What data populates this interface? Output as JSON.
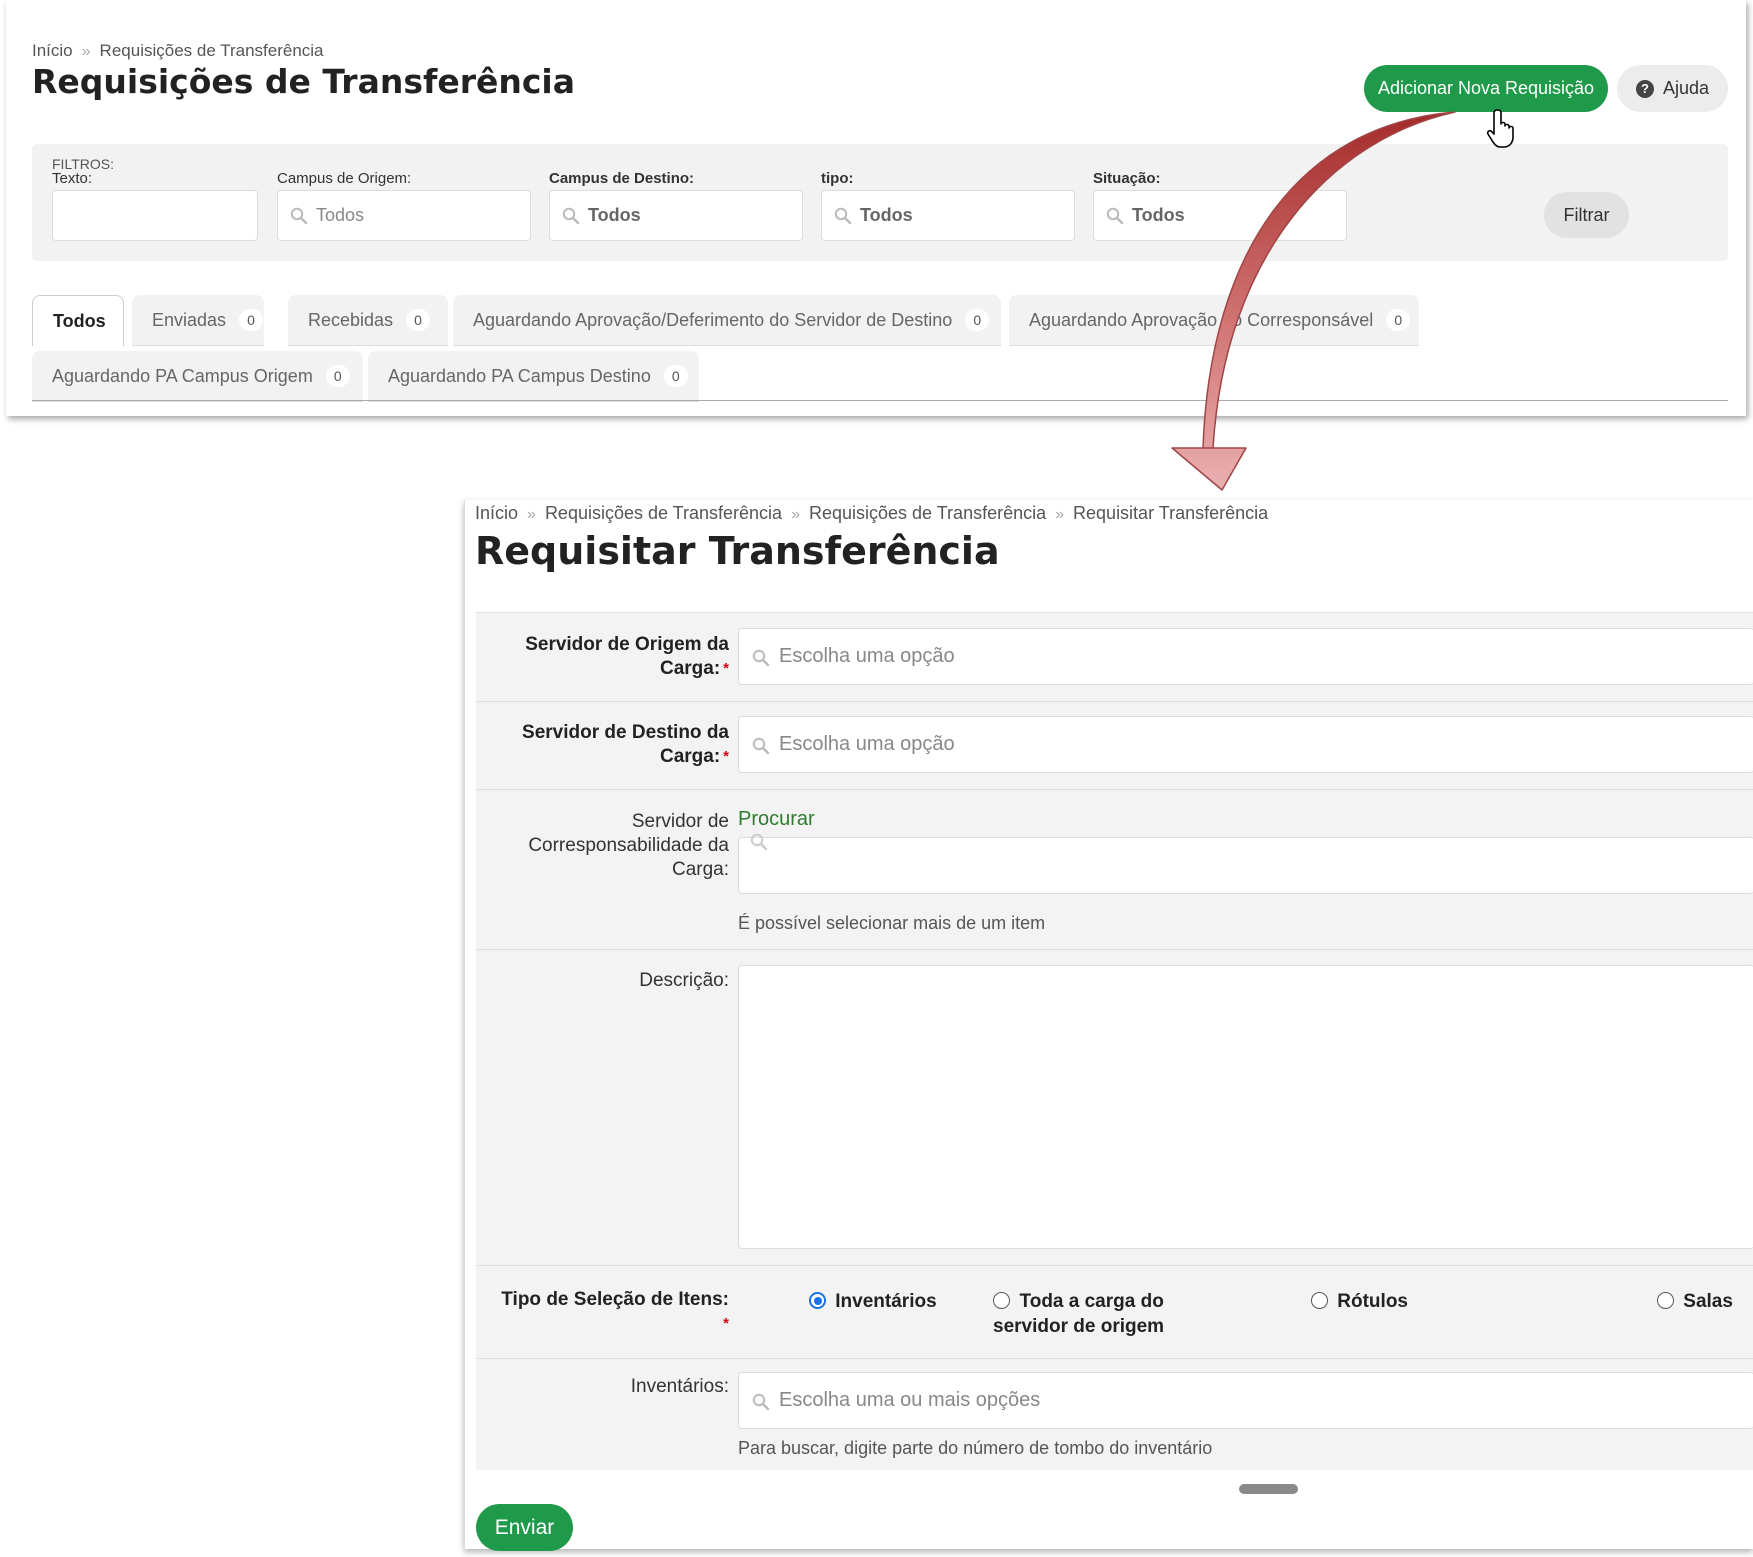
{
  "list_page": {
    "breadcrumb": [
      "Início",
      "Requisições de Transferência"
    ],
    "title": "Requisições de Transferência",
    "add_button": "Adicionar Nova Requisição",
    "help_button": "Ajuda",
    "filters": {
      "title": "FILTROS:",
      "fields": [
        {
          "label": "Texto:",
          "value": ""
        },
        {
          "label": "Campus de Origem:",
          "value": "Todos"
        },
        {
          "label": "Campus de Destino:",
          "value": "Todos"
        },
        {
          "label": "tipo:",
          "value": "Todos"
        },
        {
          "label": "Situação:",
          "value": "Todos"
        }
      ],
      "filter_button": "Filtrar"
    },
    "tabs": [
      {
        "label": "Todos",
        "count": ""
      },
      {
        "label": "Enviadas",
        "count": "0"
      },
      {
        "label": "Recebidas",
        "count": "0"
      },
      {
        "label": "Aguardando Aprovação/Deferimento do Servidor de Destino",
        "count": "0"
      },
      {
        "label": "Aguardando Aprovação do Corresponsável",
        "count": "0"
      },
      {
        "label": "Aguardando PA Campus Origem",
        "count": "0"
      },
      {
        "label": "Aguardando PA Campus Destino",
        "count": "0"
      }
    ]
  },
  "form_page": {
    "breadcrumb": [
      "Início",
      "Requisições de Transferência",
      "Requisições de Transferência",
      "Requisitar Transferência"
    ],
    "title": "Requisitar Transferência",
    "fields": {
      "origem": {
        "label_line1": "Servidor de Origem da",
        "label_line2": "Carga:",
        "placeholder": "Escolha uma opção"
      },
      "destino": {
        "label_line1": "Servidor de Destino da",
        "label_line2": "Carga:",
        "placeholder": "Escolha uma opção"
      },
      "corresponsabilidade": {
        "label_line1": "Servidor de",
        "label_line2": "Corresponsabilidade da",
        "label_line3": "Carga:",
        "search_text": "Procurar",
        "help": "É possível selecionar mais de um item"
      },
      "descricao": {
        "label": "Descrição:"
      },
      "tipo_selecao": {
        "label": "Tipo de Seleção de Itens:",
        "options": [
          {
            "label": "Inventários",
            "checked": true
          },
          {
            "label_line1": "Toda a carga do",
            "label_line2": "servidor de origem",
            "checked": false
          },
          {
            "label": "Rótulos",
            "checked": false
          },
          {
            "label": "Salas",
            "checked": false
          }
        ]
      },
      "inventarios": {
        "label": "Inventários:",
        "placeholder": "Escolha uma ou mais opções",
        "help": "Para buscar, digite parte do número de tombo do inventário"
      }
    },
    "submit_button": "Enviar"
  },
  "required_mark": "*",
  "colors": {
    "primary": "#1f9a4a",
    "arrow": "#c85a5a",
    "radio_checked": "#1a73e8",
    "link": "#2e7d2e"
  }
}
